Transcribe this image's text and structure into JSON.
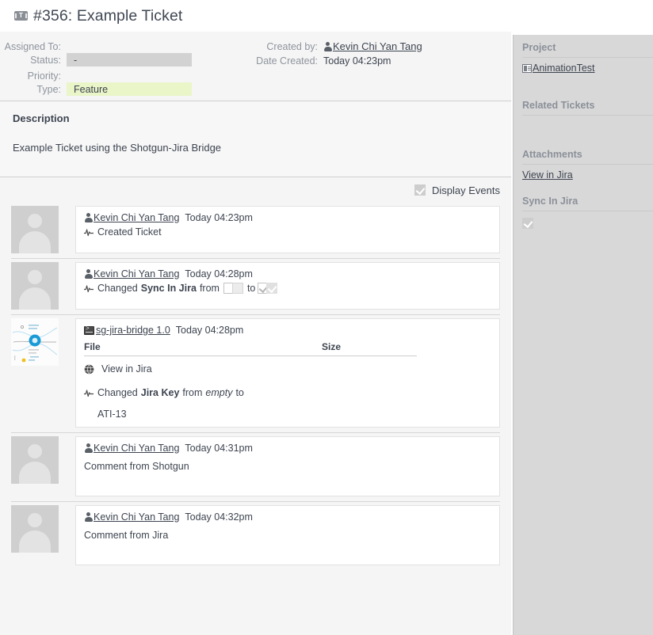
{
  "titlebar": {
    "icon": "ticket-icon",
    "icon_letter": "T",
    "title": "#356: Example Ticket"
  },
  "fields": {
    "assigned_to_label": "Assigned To:",
    "assigned_to_value": "",
    "status_label": "Status:",
    "status_value": "-",
    "priority_label": "Priority:",
    "priority_value": "",
    "type_label": "Type:",
    "type_value": "Feature",
    "created_by_label": "Created by:",
    "created_by_value": "Kevin Chi Yan Tang",
    "date_created_label": "Date Created:",
    "date_created_value": "Today 04:23pm"
  },
  "description": {
    "heading": "Description",
    "body": "Example Ticket using the Shotgun-Jira Bridge"
  },
  "events_bar": {
    "display_events_label": "Display Events",
    "display_events_checked": true
  },
  "events": [
    {
      "kind": "avatar",
      "author": "Kevin Chi Yan Tang",
      "time": "Today 04:23pm",
      "action": "Created Ticket"
    },
    {
      "kind": "avatar",
      "author": "Kevin Chi Yan Tang",
      "time": "Today 04:28pm",
      "changed_prefix": "Changed",
      "field": "Sync In Jira",
      "from_label": "from",
      "to_label": "to",
      "from_checked": false,
      "to_checked": true
    },
    {
      "kind": "thumbnail",
      "author": "sg-jira-bridge 1.0",
      "time": "Today 04:28pm",
      "table": {
        "col_file": "File",
        "col_size": "Size",
        "rows": [
          {
            "file": "View in Jira",
            "size": "",
            "icon": "globe-icon"
          }
        ]
      },
      "changed_prefix": "Changed",
      "field": "Jira Key",
      "from_label": "from",
      "from_value": "empty",
      "to_label": "to",
      "to_value": "ATI-13"
    },
    {
      "kind": "avatar",
      "author": "Kevin Chi Yan Tang",
      "time": "Today 04:31pm",
      "comment": "Comment from Shotgun"
    },
    {
      "kind": "avatar",
      "author": "Kevin Chi Yan Tang",
      "time": "Today 04:32pm",
      "comment": "Comment from Jira"
    }
  ],
  "sidebar": {
    "project_title": "Project",
    "project_name": "AnimationTest",
    "related_tickets_title": "Related Tickets",
    "attachments_title": "Attachments",
    "attachment_link": "View in Jira",
    "sync_in_jira_title": "Sync In Jira",
    "sync_in_jira_checked": true
  },
  "colors": {
    "status_pill": "#d2d2d2",
    "type_pill": "#eaf5c8",
    "sidebar_bg": "#d8d8d8",
    "main_bg": "#f5f5f5",
    "text": "#3d4450",
    "label": "#8e949d"
  }
}
